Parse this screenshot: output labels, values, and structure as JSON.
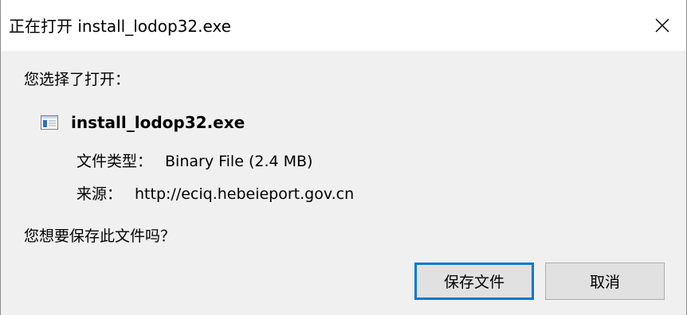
{
  "window": {
    "title": "正在打开 install_lodop32.exe",
    "close_icon": "close-icon"
  },
  "content": {
    "prompt": "您选择了打开：",
    "file_icon": "exe-file-icon",
    "file_name": "install_lodop32.exe",
    "type_label": "文件类型：",
    "type_value": "Binary File (2.4 MB)",
    "source_label": "来源：",
    "source_value": "http://eciq.hebeieport.gov.cn",
    "question": "您想要保存此文件吗？"
  },
  "buttons": {
    "save_label": "保存文件",
    "cancel_label": "取消"
  },
  "colors": {
    "focus_border": "#0078d7",
    "dialog_bg": "#f0f0f0",
    "button_bg": "#e1e1e1"
  }
}
